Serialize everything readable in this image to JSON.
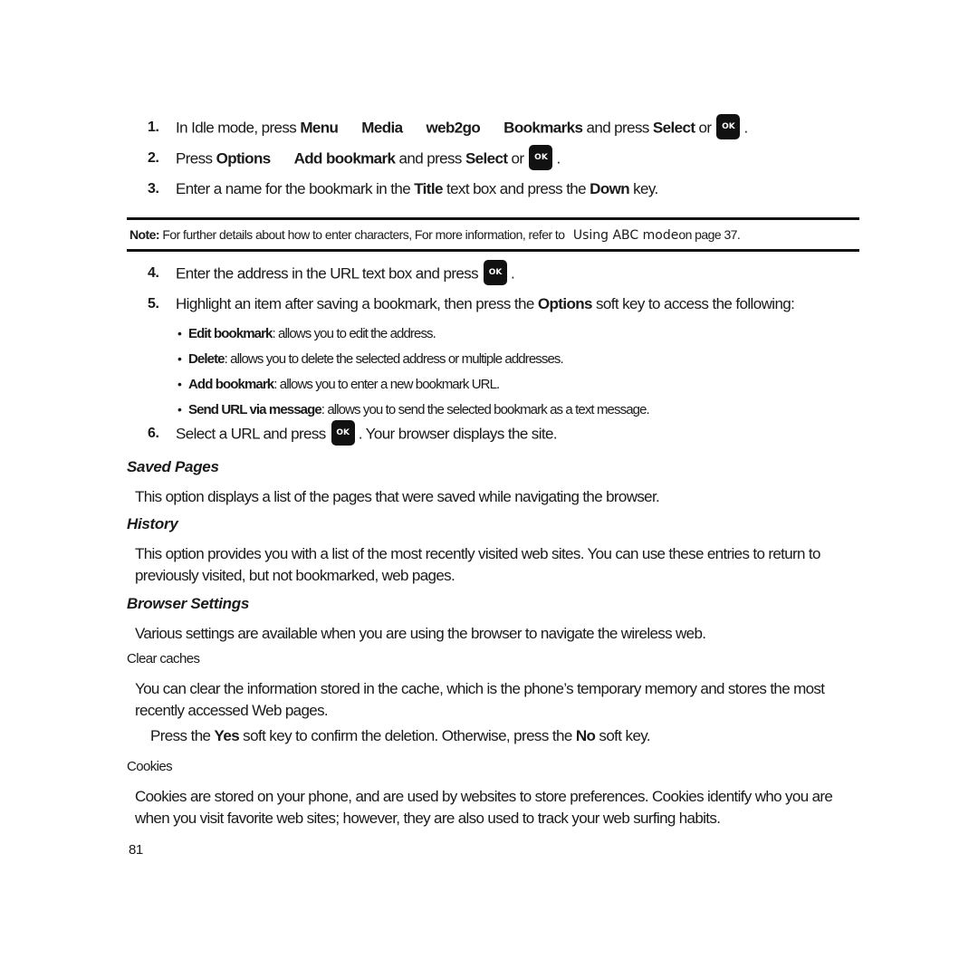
{
  "steps": {
    "s1": {
      "num": "1.",
      "pre": "In Idle mode, press ",
      "menu": "Menu",
      "media": "Media",
      "web2go": "web2go",
      "bookmarks": "Bookmarks",
      "mid": " and press ",
      "select": "Select",
      "or": " or",
      "end": "."
    },
    "s2": {
      "num": "2.",
      "pre": "Press ",
      "options": "Options",
      "add": "Add bookmark",
      "mid": " and press ",
      "select": "Select",
      "or": " or",
      "end": "."
    },
    "s3": {
      "num": "3.",
      "pre": "Enter a name for the bookmark in the ",
      "title": "Title",
      "mid": " text box and press the ",
      "down": "Down",
      "end": " key."
    },
    "s4": {
      "num": "4.",
      "text": "Enter the address in the URL text box and press",
      "end": "."
    },
    "s5": {
      "num": "5.",
      "pre": "Highlight an item after saving a bookmark, then press the ",
      "options": "Options",
      "end": " soft key to access the following:"
    },
    "s6": {
      "num": "6.",
      "pre": "Select a URL and press",
      "end": ". Your browser displays the site."
    }
  },
  "ok_key_label": "OK",
  "note": {
    "label": "Note:",
    "text": " For further details about how to enter characters, For more information, refer to ",
    "ref": "Using ABC mode",
    "end": "on page 37."
  },
  "options_list": [
    {
      "term": "Edit bookmark",
      "desc": ": allows you to edit the address."
    },
    {
      "term": "Delete",
      "desc": ": allows you to delete the selected address or multiple addresses."
    },
    {
      "term": "Add bookmark",
      "desc": ": allows you to enter a new bookmark URL."
    },
    {
      "term": "Send URL via message",
      "desc": ": allows you to send the selected bookmark as a text message."
    }
  ],
  "bullet_char": "•",
  "sections": {
    "saved_pages": {
      "heading": "Saved Pages",
      "body": "This option displays a list of the pages that were saved while navigating the browser."
    },
    "history": {
      "heading": "History",
      "body": "This option provides you with a list of the most recently visited web sites. You can use these entries to return to previously visited, but not bookmarked, web pages."
    },
    "browser_settings": {
      "heading": "Browser Settings",
      "body": "Various settings are available when you are using the browser to navigate the wireless web."
    },
    "clear_caches": {
      "heading": "Clear caches",
      "body": "You can clear the information stored in the cache, which is the phone’s temporary memory and stores the most recently accessed Web pages.",
      "confirm_pre": "Press the ",
      "yes": "Yes",
      "confirm_mid": " soft key to confirm the deletion. Otherwise, press the ",
      "no": "No",
      "confirm_end": " soft key."
    },
    "cookies": {
      "heading": "Cookies",
      "body": "Cookies are stored on your phone, and are used by websites to store preferences. Cookies identify who you are when you visit favorite web sites; however, they are also used to track your web surfing habits."
    }
  },
  "page_number": "81"
}
